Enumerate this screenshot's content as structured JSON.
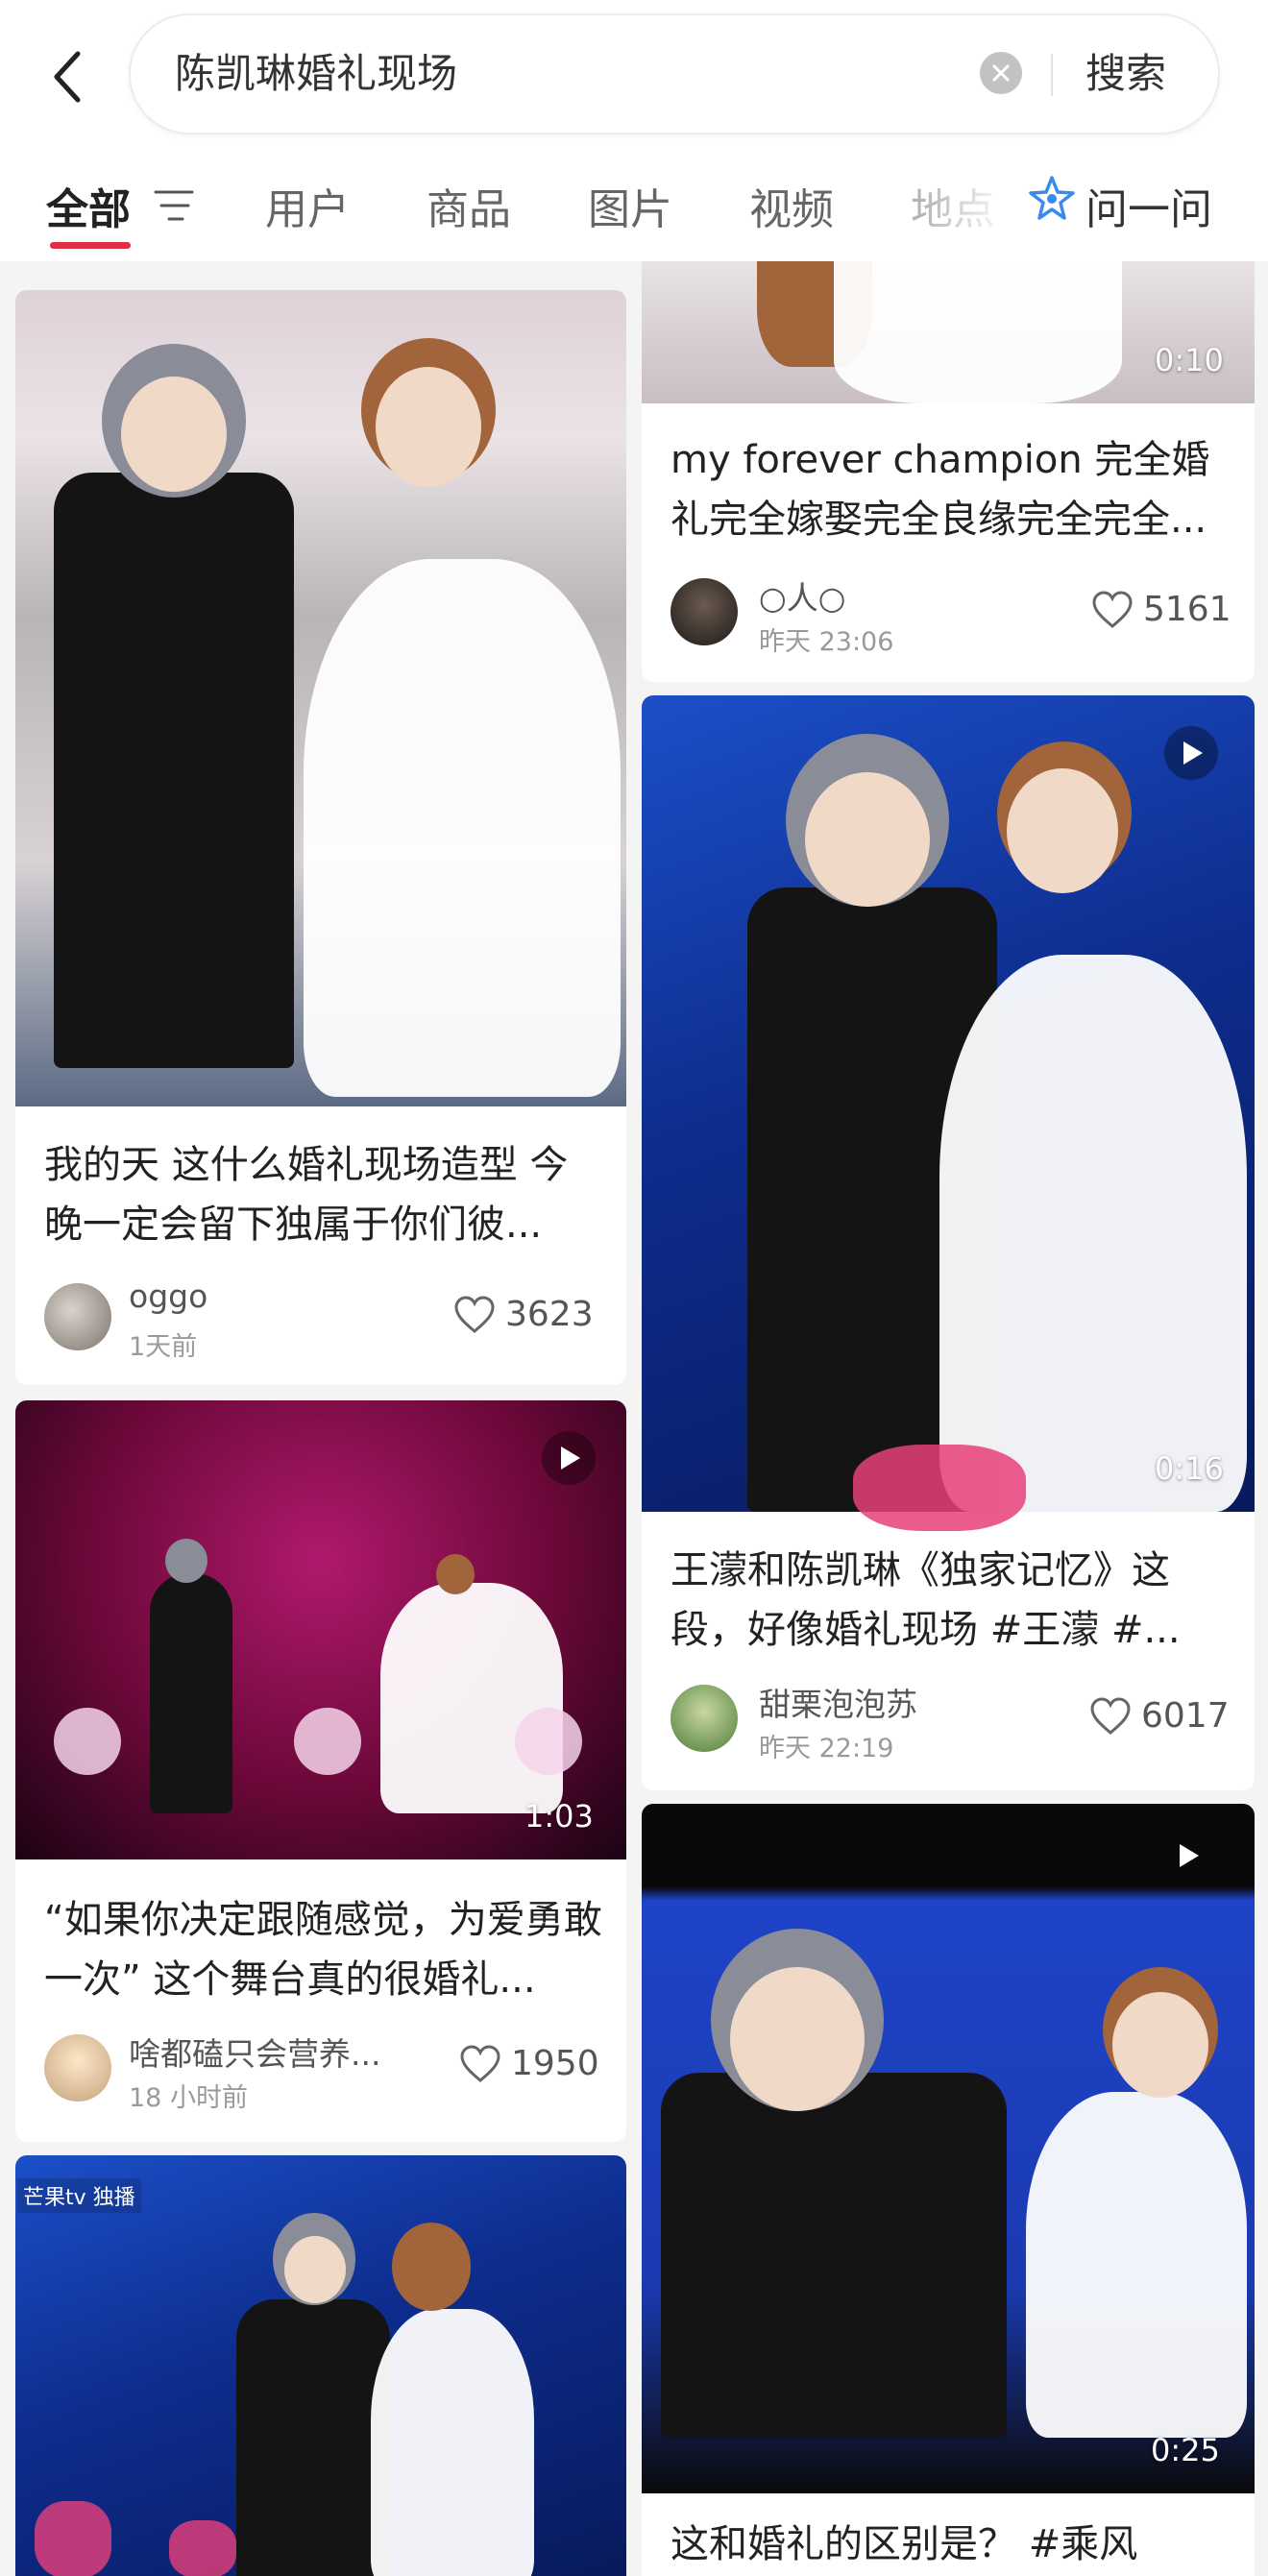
{
  "search": {
    "query": "陈凯琳婚礼现场",
    "submit_label": "搜索"
  },
  "tabs": [
    {
      "label": "全部"
    },
    {
      "label": "用户"
    },
    {
      "label": "商品"
    },
    {
      "label": "图片"
    },
    {
      "label": "视频"
    },
    {
      "label": "地点"
    }
  ],
  "ask": {
    "label": "问一问"
  },
  "icons": {
    "back": "chevron-left-icon",
    "clear": "clear-icon",
    "filter": "filter-icon",
    "ask": "star-sparkle-icon",
    "play": "play-icon",
    "like": "heart-outline-icon"
  },
  "colors": {
    "accent": "#e02e45"
  },
  "feed": {
    "left": [
      {
        "title": "我的天 这什么婚礼现场造型 今晚一定会留下独属于你们彼...",
        "author": "oggo",
        "time": "1天前",
        "likes": "3623",
        "is_video": false
      },
      {
        "title": "“如果你决定跟随感觉，为爱勇敢一次” 这个舞台真的很婚礼...",
        "author": "啥都磕只会营养...",
        "time": "18 小时前",
        "likes": "1950",
        "is_video": true,
        "duration": "1:03"
      },
      {
        "overlay_logo": "芒果tv 独播",
        "is_video": true
      }
    ],
    "right": [
      {
        "title": "my forever champion 完全婚礼完全嫁娶完全良缘完全完全...",
        "author": "○人○",
        "time": "昨天 23:06",
        "likes": "5161",
        "is_video": true,
        "duration": "0:10"
      },
      {
        "title": "王濛和陈凯琳《独家记忆》这段，好像婚礼现场 #王濛 #...",
        "author": "甜栗泡泡苏",
        "time": "昨天 22:19",
        "likes": "6017",
        "is_video": true,
        "duration": "0:16"
      },
      {
        "title": "这和婚礼的区别是？ #乘风",
        "is_video": true,
        "duration": "0:25"
      }
    ]
  }
}
